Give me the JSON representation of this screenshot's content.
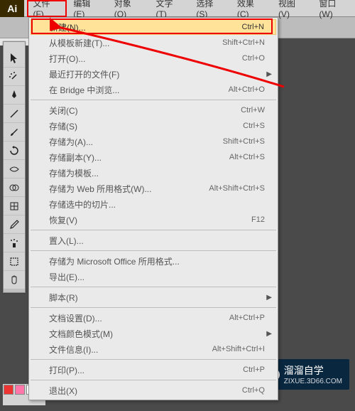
{
  "app_icon": "Ai",
  "menubar": {
    "items": [
      "文件(F)",
      "编辑(E)",
      "对象(O)",
      "文字(T)",
      "选择(S)",
      "效果(C)",
      "视图(V)",
      "窗口(W)"
    ]
  },
  "file_menu": {
    "groups": [
      [
        {
          "label": "新建(N)...",
          "shortcut": "Ctrl+N",
          "highlight": true
        },
        {
          "label": "从模板新建(T)...",
          "shortcut": "Shift+Ctrl+N"
        },
        {
          "label": "打开(O)...",
          "shortcut": "Ctrl+O"
        },
        {
          "label": "最近打开的文件(F)",
          "submenu": true
        },
        {
          "label": "在 Bridge 中浏览...",
          "shortcut": "Alt+Ctrl+O"
        }
      ],
      [
        {
          "label": "关闭(C)",
          "shortcut": "Ctrl+W"
        },
        {
          "label": "存储(S)",
          "shortcut": "Ctrl+S"
        },
        {
          "label": "存储为(A)...",
          "shortcut": "Shift+Ctrl+S"
        },
        {
          "label": "存储副本(Y)...",
          "shortcut": "Alt+Ctrl+S"
        },
        {
          "label": "存储为模板..."
        },
        {
          "label": "存储为 Web 所用格式(W)...",
          "shortcut": "Alt+Shift+Ctrl+S"
        },
        {
          "label": "存储选中的切片..."
        },
        {
          "label": "恢复(V)",
          "shortcut": "F12"
        }
      ],
      [
        {
          "label": "置入(L)..."
        }
      ],
      [
        {
          "label": "存储为 Microsoft Office 所用格式..."
        },
        {
          "label": "导出(E)..."
        }
      ],
      [
        {
          "label": "脚本(R)",
          "submenu": true
        }
      ],
      [
        {
          "label": "文档设置(D)...",
          "shortcut": "Alt+Ctrl+P"
        },
        {
          "label": "文档颜色模式(M)",
          "submenu": true
        },
        {
          "label": "文件信息(I)...",
          "shortcut": "Alt+Shift+Ctrl+I"
        }
      ],
      [
        {
          "label": "打印(P)...",
          "shortcut": "Ctrl+P"
        }
      ],
      [
        {
          "label": "退出(X)",
          "shortcut": "Ctrl+Q"
        }
      ]
    ]
  },
  "watermark": {
    "title": "溜溜自学",
    "sub": "ZIXUE.3D66.COM"
  }
}
